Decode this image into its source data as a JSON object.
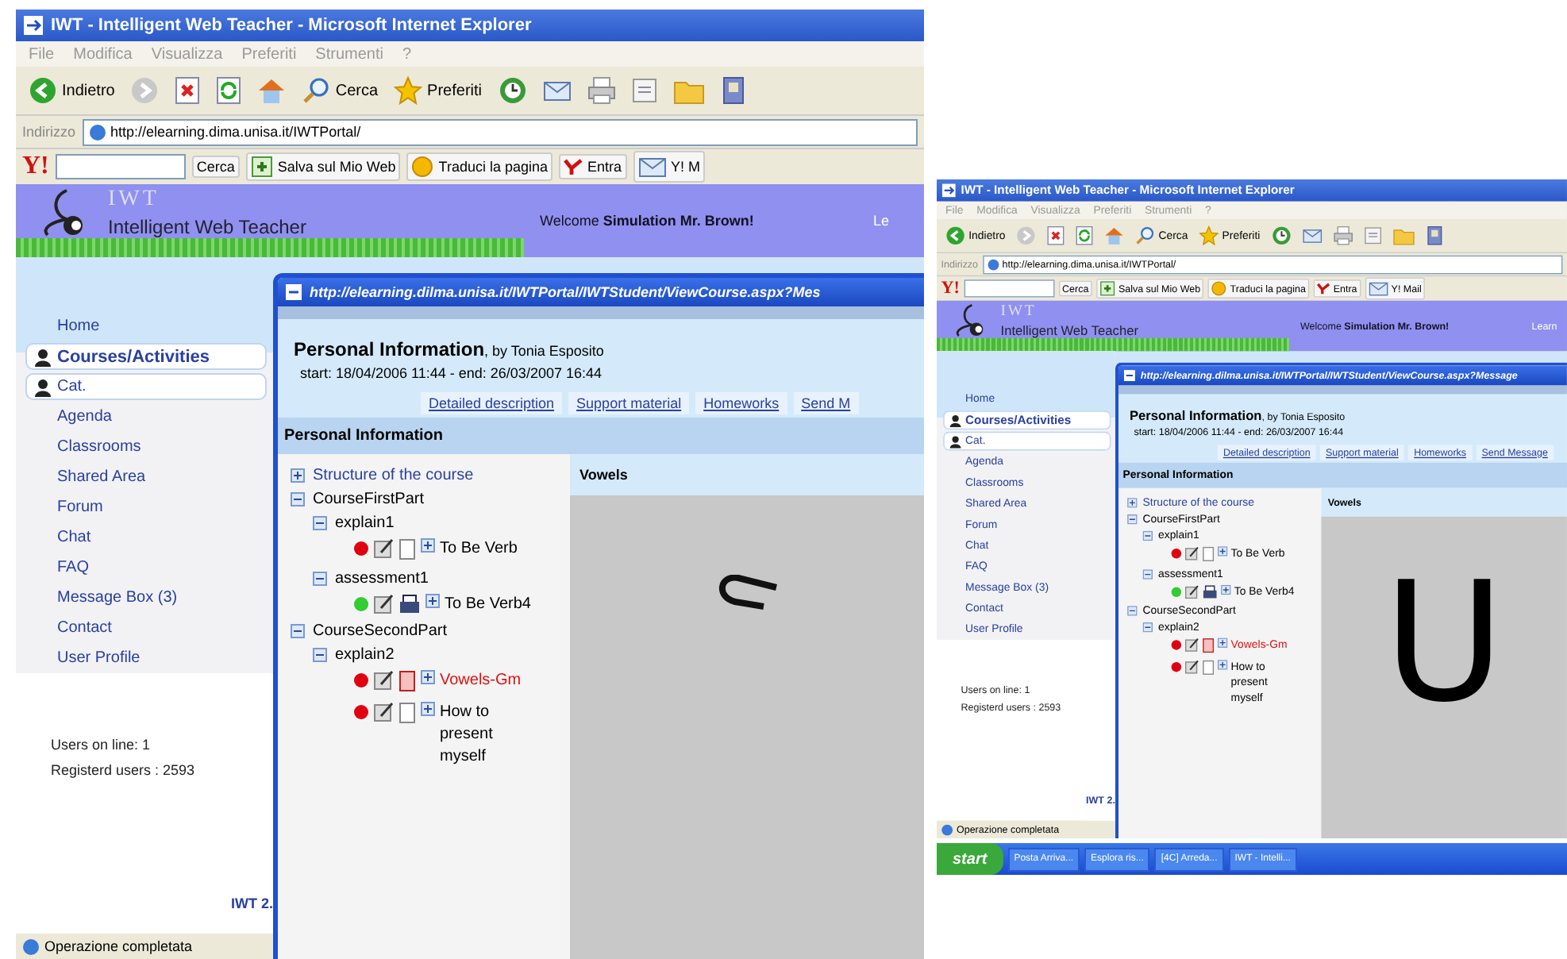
{
  "screens": [
    {
      "window": {
        "title": "IWT - Intelligent Web Teacher - Microsoft Internet Explorer"
      },
      "menu": [
        "File",
        "Modifica",
        "Visualizza",
        "Preferiti",
        "Strumenti",
        "?"
      ],
      "toolbar": [
        {
          "kind": "back",
          "label": "Indietro"
        },
        {
          "kind": "forward"
        },
        {
          "kind": "stop"
        },
        {
          "kind": "refresh"
        },
        {
          "kind": "home"
        },
        {
          "kind": "search",
          "label": "Cerca"
        },
        {
          "kind": "favorites",
          "label": "Preferiti"
        },
        {
          "kind": "history"
        },
        {
          "kind": "mail"
        },
        {
          "kind": "print"
        },
        {
          "kind": "edit"
        },
        {
          "kind": "folder"
        },
        {
          "kind": "messenger"
        }
      ],
      "address": {
        "label": "Indirizzo",
        "url": "http://elearning.dima.unisa.it/IWTPortal/"
      },
      "yahoo_bar": {
        "logo": "Y!",
        "search_button": "Cerca",
        "buttons": [
          {
            "kind": "save",
            "label": "Salva sul Mio Web"
          },
          {
            "kind": "translate",
            "label": "Traduci la pagina"
          },
          {
            "kind": "signin",
            "label": "Entra"
          },
          {
            "kind": "mail",
            "label": "Y! M"
          }
        ]
      },
      "banner": {
        "logo": "IWT",
        "subtitle": "Intelligent Web Teacher",
        "welcome": "Welcome",
        "user": "Simulation Mr. Brown!",
        "link": "Le"
      },
      "sidebar": {
        "items": [
          {
            "label": "Home",
            "kind": "link",
            "selected": false
          },
          {
            "label": "Courses/Activities",
            "kind": "category",
            "selected": true
          },
          {
            "label": "Cat.",
            "kind": "category",
            "selected": false
          },
          {
            "label": "Agenda",
            "kind": "link",
            "selected": false
          },
          {
            "label": "Classrooms",
            "kind": "link",
            "selected": false
          },
          {
            "label": "Shared Area",
            "kind": "link",
            "selected": false
          },
          {
            "label": "Forum",
            "kind": "link",
            "selected": false
          },
          {
            "label": "Chat",
            "kind": "link",
            "selected": false
          },
          {
            "label": "FAQ",
            "kind": "link",
            "selected": false
          },
          {
            "label": "Message Box (3)",
            "kind": "link",
            "selected": false
          },
          {
            "label": "Contact",
            "kind": "link",
            "selected": false
          },
          {
            "label": "User Profile",
            "kind": "link",
            "selected": false
          }
        ],
        "users_online": "Users on line: 1",
        "registered": "Registerd users : 2593",
        "version": "IWT 2."
      },
      "status_bar": "Operazione completata",
      "popup": {
        "url": "http://elearning.dilma.unisa.it/IWTPortal/IWTStudent/ViewCourse.aspx?Mes",
        "title": "Personal Information",
        "author": ", by Tonia Esposito",
        "dates": "start: 18/04/2006 11:44 - end: 26/03/2007 16:44",
        "tabs": [
          "Detailed description",
          "Support material",
          "Homeworks",
          "Send M"
        ],
        "section": "Personal Information",
        "tree": [
          {
            "label": "Structure of the course",
            "expanded": false
          },
          {
            "label": "CourseFirstPart",
            "expanded": true,
            "children": [
              {
                "label": "explain1",
                "expanded": true,
                "children": [
                  {
                    "label": "To Be Verb",
                    "kind": "lesson",
                    "color": "#e00010",
                    "highlighted": false
                  }
                ]
              },
              {
                "label": "assessment1",
                "expanded": true,
                "children": [
                  {
                    "label": "To Be Verb4",
                    "kind": "test",
                    "color": "#33cc33",
                    "highlighted": false
                  }
                ]
              }
            ]
          },
          {
            "label": "CourseSecondPart",
            "expanded": true,
            "children": [
              {
                "label": "explain2",
                "expanded": true,
                "children": [
                  {
                    "label": "Vowels-Gm",
                    "kind": "media",
                    "color": "#e00010",
                    "highlighted": true
                  },
                  {
                    "label": "How to present myself",
                    "kind": "lesson",
                    "color": "#e00010",
                    "highlighted": false
                  }
                ]
              }
            ]
          }
        ],
        "content": {
          "heading": "Vowels"
        }
      }
    },
    {
      "window": {
        "title": "IWT - Intelligent Web Teacher - Microsoft Internet Explorer"
      },
      "menu": [
        "File",
        "Modifica",
        "Visualizza",
        "Preferiti",
        "Strumenti",
        "?"
      ],
      "toolbar": [
        {
          "kind": "back",
          "label": "Indietro"
        },
        {
          "kind": "forward"
        },
        {
          "kind": "stop"
        },
        {
          "kind": "refresh"
        },
        {
          "kind": "home"
        },
        {
          "kind": "search",
          "label": "Cerca"
        },
        {
          "kind": "favorites",
          "label": "Preferiti"
        },
        {
          "kind": "history"
        },
        {
          "kind": "mail"
        },
        {
          "kind": "print"
        },
        {
          "kind": "edit"
        },
        {
          "kind": "folder"
        },
        {
          "kind": "messenger"
        }
      ],
      "address": {
        "label": "Indirizzo",
        "url": "http://elearning.dima.unisa.it/IWTPortal/"
      },
      "yahoo_bar": {
        "logo": "Y!",
        "search_button": "Cerca",
        "buttons": [
          {
            "kind": "save",
            "label": "Salva sul Mio Web"
          },
          {
            "kind": "translate",
            "label": "Traduci la pagina"
          },
          {
            "kind": "signin",
            "label": "Entra"
          },
          {
            "kind": "mail",
            "label": "Y! Mail"
          }
        ]
      },
      "banner": {
        "logo": "IWT",
        "subtitle": "Intelligent Web Teacher",
        "welcome": "Welcome",
        "user": "Simulation Mr. Brown!",
        "link": "Learn"
      },
      "sidebar": {
        "items": [
          {
            "label": "Home",
            "kind": "link",
            "selected": false
          },
          {
            "label": "Courses/Activities",
            "kind": "category",
            "selected": true
          },
          {
            "label": "Cat.",
            "kind": "category",
            "selected": false
          },
          {
            "label": "Agenda",
            "kind": "link",
            "selected": false
          },
          {
            "label": "Classrooms",
            "kind": "link",
            "selected": false
          },
          {
            "label": "Shared Area",
            "kind": "link",
            "selected": false
          },
          {
            "label": "Forum",
            "kind": "link",
            "selected": false
          },
          {
            "label": "Chat",
            "kind": "link",
            "selected": false
          },
          {
            "label": "FAQ",
            "kind": "link",
            "selected": false
          },
          {
            "label": "Message Box (3)",
            "kind": "link",
            "selected": false
          },
          {
            "label": "Contact",
            "kind": "link",
            "selected": false
          },
          {
            "label": "User Profile",
            "kind": "link",
            "selected": false
          }
        ],
        "users_online": "Users on line: 1",
        "registered": "Registerd users : 2593",
        "version": "IWT 2."
      },
      "status_bar": "Operazione completata",
      "popup": {
        "url": "http://elearning.dilma.unisa.it/IWTPortal/IWTStudent/ViewCourse.aspx?Message",
        "title": "Personal Information",
        "author": ", by Tonia Esposito",
        "dates": "start: 18/04/2006 11:44 - end: 26/03/2007 16:44",
        "tabs": [
          "Detailed description",
          "Support material",
          "Homeworks",
          "Send Message"
        ],
        "section": "Personal Information",
        "tree": [
          {
            "label": "Structure of the course",
            "expanded": false
          },
          {
            "label": "CourseFirstPart",
            "expanded": true,
            "children": [
              {
                "label": "explain1",
                "expanded": true,
                "children": [
                  {
                    "label": "To Be Verb",
                    "kind": "lesson",
                    "color": "#e00010",
                    "highlighted": false
                  }
                ]
              },
              {
                "label": "assessment1",
                "expanded": true,
                "children": [
                  {
                    "label": "To Be Verb4",
                    "kind": "test",
                    "color": "#33cc33",
                    "highlighted": false
                  }
                ]
              }
            ]
          },
          {
            "label": "CourseSecondPart",
            "expanded": true,
            "children": [
              {
                "label": "explain2",
                "expanded": true,
                "children": [
                  {
                    "label": "Vowels-Gm",
                    "kind": "media",
                    "color": "#e00010",
                    "highlighted": true
                  },
                  {
                    "label": "How to present myself",
                    "kind": "lesson",
                    "color": "#e00010",
                    "highlighted": false
                  }
                ]
              }
            ]
          }
        ],
        "content": {
          "heading": "Vowels",
          "letter": "U"
        }
      },
      "taskbar": {
        "start": "start",
        "items": [
          "Posta Arriva...",
          "Esplora ris...",
          "[4C] Arreda...",
          "IWT - Intelli..."
        ]
      }
    }
  ]
}
